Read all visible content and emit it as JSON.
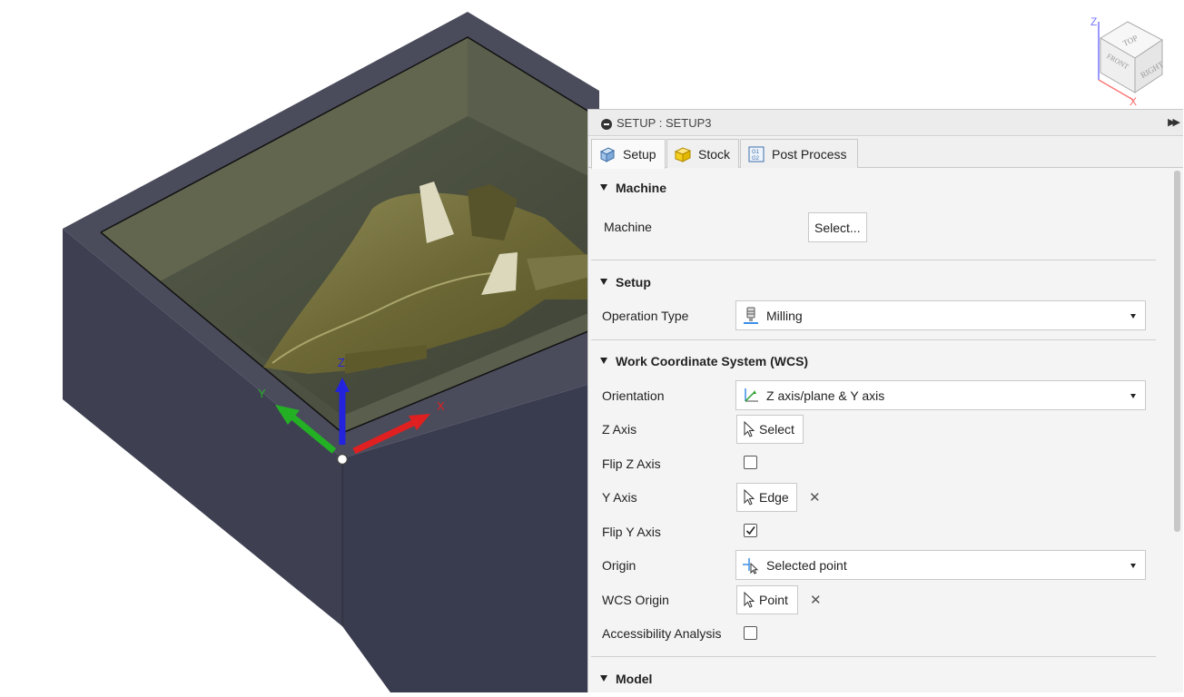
{
  "viewport": {
    "axis_labels": {
      "z": "Z",
      "y": "Y",
      "x": "X"
    },
    "viewcube": {
      "faces": {
        "top": "TOP",
        "front": "FRONT",
        "right": "RIGHT"
      },
      "z": "Z",
      "x": "X"
    }
  },
  "panel": {
    "title": "SETUP : SETUP3",
    "tabs": [
      {
        "label": "Setup",
        "icon": "setup-icon",
        "active": true
      },
      {
        "label": "Stock",
        "icon": "stock-icon",
        "active": false
      },
      {
        "label": "Post Process",
        "icon": "post-process-icon",
        "active": false
      }
    ],
    "sections": {
      "machine": {
        "title": "Machine",
        "machine_label": "Machine",
        "select_button": "Select..."
      },
      "setup": {
        "title": "Setup",
        "operation_type_label": "Operation Type",
        "operation_type_value": "Milling"
      },
      "wcs": {
        "title": "Work Coordinate System (WCS)",
        "orientation_label": "Orientation",
        "orientation_value": "Z axis/plane & Y axis",
        "z_axis_label": "Z Axis",
        "z_axis_button": "Select",
        "flip_z_label": "Flip Z Axis",
        "flip_z_checked": false,
        "y_axis_label": "Y Axis",
        "y_axis_button": "Edge",
        "flip_y_label": "Flip Y Axis",
        "flip_y_checked": true,
        "origin_label": "Origin",
        "origin_value": "Selected point",
        "wcs_origin_label": "WCS Origin",
        "wcs_origin_button": "Point",
        "accessibility_label": "Accessibility Analysis",
        "accessibility_checked": false
      },
      "model": {
        "title": "Model"
      }
    }
  },
  "colors": {
    "stock_box": "#3b3d52",
    "part": "#6f6a3a",
    "axis_x": "#e02020",
    "axis_y": "#24b024",
    "axis_z": "#2323dd",
    "panel_bg": "#f4f4f4"
  }
}
